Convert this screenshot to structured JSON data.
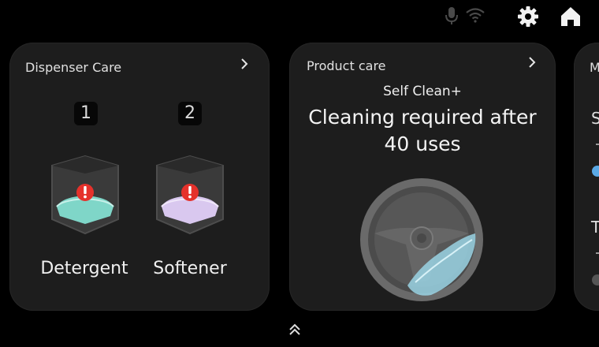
{
  "status_bar": {
    "icons": [
      "microphone-icon",
      "wifi-icon",
      "gear-icon",
      "home-icon"
    ]
  },
  "dispenser_care": {
    "title": "Dispenser Care",
    "slots": [
      {
        "number": "1",
        "label": "Detergent",
        "fluid_color": "#7fd6c8"
      },
      {
        "number": "2",
        "label": "Softener",
        "fluid_color": "#d9c8ef"
      }
    ],
    "alert_color": "#e5312b"
  },
  "product_care": {
    "title": "Product care",
    "subtitle": "Self Clean+",
    "message_line1": "Cleaning required after",
    "message_line2": "40 uses"
  },
  "third_card": {
    "title_partial": "M",
    "row1_letter": "S",
    "row2_letter": "T",
    "toggle_on_color": "#5aa9e6",
    "toggle_off_color": "#555555"
  }
}
